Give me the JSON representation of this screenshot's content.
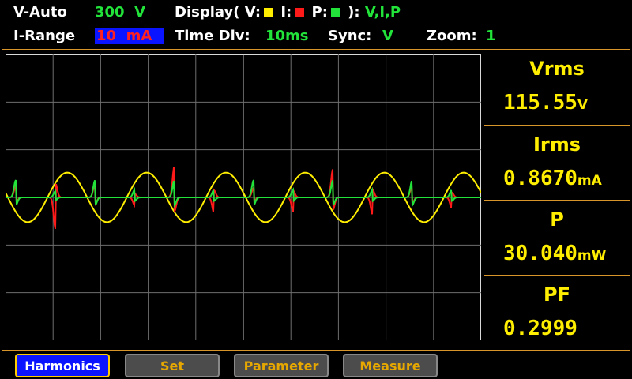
{
  "header": {
    "mode_label": "V-Auto",
    "voltage_range": "300",
    "voltage_unit": "V",
    "display_label": "Display( V:",
    "display_i_label": "I:",
    "display_p_label": "P:",
    "display_close": "):",
    "display_value": "V,I,P",
    "irange_label": "I-Range",
    "irange_value": "10  mA",
    "timediv_label": "Time  Div:",
    "timediv_value": "10ms",
    "sync_label": "Sync:",
    "sync_value": "V",
    "zoom_label": "Zoom:",
    "zoom_value": "1"
  },
  "legend_colors": {
    "v": "#ffee00",
    "i": "#ff1a1a",
    "p": "#22e33a"
  },
  "measurements": [
    {
      "label": "Vrms",
      "value": "115.55",
      "unit": "V"
    },
    {
      "label": "Irms",
      "value": "0.8670",
      "unit": "mA"
    },
    {
      "label": "P",
      "value": "30.040",
      "unit": "mW"
    },
    {
      "label": "PF",
      "value": "0.2999",
      "unit": ""
    }
  ],
  "buttons": {
    "harmonics": "Harmonics",
    "set": "Set",
    "parameter": "Parameter",
    "measure": "Measure"
  },
  "chart_data": {
    "type": "line",
    "grid": true,
    "x_divisions": 10,
    "y_divisions": 6,
    "cycles_shown": 6,
    "series": [
      {
        "name": "V",
        "color": "#ffee00",
        "waveform": "sine",
        "amplitude_div": 0.52
      },
      {
        "name": "I",
        "color": "#ff1a1a",
        "waveform": "pulse",
        "pulses_per_cycle": 2
      },
      {
        "name": "P",
        "color": "#22e33a",
        "waveform": "pulse",
        "pulses_per_cycle": 2
      }
    ]
  }
}
